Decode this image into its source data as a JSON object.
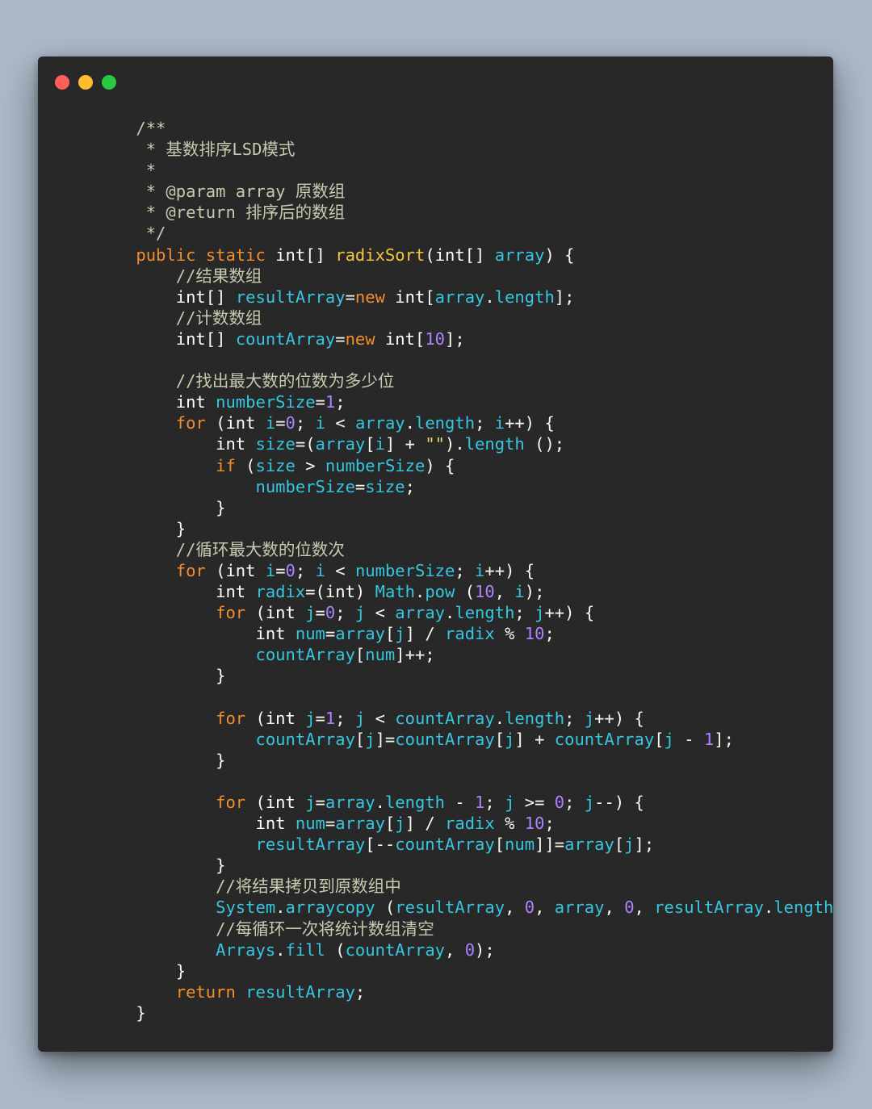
{
  "window": {
    "traffic_lights": [
      {
        "name": "close",
        "color": "#fe5f57"
      },
      {
        "name": "minimize",
        "color": "#febc2e"
      },
      {
        "name": "maximize",
        "color": "#28c840"
      }
    ]
  },
  "colors": {
    "background": "#abb9c8",
    "editor_background": "#282828",
    "comment": "#c9c9b0",
    "keyword": "#f28d2e",
    "type": "#ffffff",
    "function": "#f5c43b",
    "variable": "#36c6df",
    "number": "#ae81ff"
  },
  "code": {
    "language": "java",
    "lines": [
      [
        [
          "    /**",
          "c"
        ]
      ],
      [
        [
          "     * 基数排序LSD模式",
          "c"
        ]
      ],
      [
        [
          "     *",
          "c"
        ]
      ],
      [
        [
          "     * @param array 原数组",
          "c"
        ]
      ],
      [
        [
          "     * @return 排序后的数组",
          "c"
        ]
      ],
      [
        [
          "     */",
          "c"
        ]
      ],
      [
        [
          "    ",
          "o"
        ],
        [
          "public",
          "k"
        ],
        [
          " ",
          "o"
        ],
        [
          "static",
          "k"
        ],
        [
          " ",
          "o"
        ],
        [
          "int",
          "t"
        ],
        [
          "[] ",
          "o"
        ],
        [
          "radixSort",
          "f"
        ],
        [
          "(",
          "o"
        ],
        [
          "int",
          "t"
        ],
        [
          "[] ",
          "o"
        ],
        [
          "array",
          "v"
        ],
        [
          ") {",
          "o"
        ]
      ],
      [
        [
          "        //结果数组",
          "c"
        ]
      ],
      [
        [
          "        ",
          "o"
        ],
        [
          "int",
          "t"
        ],
        [
          "[] ",
          "o"
        ],
        [
          "resultArray",
          "v"
        ],
        [
          "=",
          "o"
        ],
        [
          "new",
          "k"
        ],
        [
          " ",
          "o"
        ],
        [
          "int",
          "t"
        ],
        [
          "[",
          "o"
        ],
        [
          "array",
          "v"
        ],
        [
          ".",
          "o"
        ],
        [
          "length",
          "v"
        ],
        [
          "];",
          "o"
        ]
      ],
      [
        [
          "        //计数数组",
          "c"
        ]
      ],
      [
        [
          "        ",
          "o"
        ],
        [
          "int",
          "t"
        ],
        [
          "[] ",
          "o"
        ],
        [
          "countArray",
          "v"
        ],
        [
          "=",
          "o"
        ],
        [
          "new",
          "k"
        ],
        [
          " ",
          "o"
        ],
        [
          "int",
          "t"
        ],
        [
          "[",
          "o"
        ],
        [
          "10",
          "n"
        ],
        [
          "];",
          "o"
        ]
      ],
      [
        [
          "",
          "o"
        ]
      ],
      [
        [
          "        //找出最大数的位数为多少位",
          "c"
        ]
      ],
      [
        [
          "        ",
          "o"
        ],
        [
          "int",
          "t"
        ],
        [
          " ",
          "o"
        ],
        [
          "numberSize",
          "v"
        ],
        [
          "=",
          "o"
        ],
        [
          "1",
          "n"
        ],
        [
          ";",
          "o"
        ]
      ],
      [
        [
          "        ",
          "o"
        ],
        [
          "for",
          "k"
        ],
        [
          " (",
          "o"
        ],
        [
          "int",
          "t"
        ],
        [
          " ",
          "o"
        ],
        [
          "i",
          "v"
        ],
        [
          "=",
          "o"
        ],
        [
          "0",
          "n"
        ],
        [
          "; ",
          "o"
        ],
        [
          "i",
          "v"
        ],
        [
          " < ",
          "o"
        ],
        [
          "array",
          "v"
        ],
        [
          ".",
          "o"
        ],
        [
          "length",
          "v"
        ],
        [
          "; ",
          "o"
        ],
        [
          "i",
          "v"
        ],
        [
          "++) {",
          "o"
        ]
      ],
      [
        [
          "            ",
          "o"
        ],
        [
          "int",
          "t"
        ],
        [
          " ",
          "o"
        ],
        [
          "size",
          "v"
        ],
        [
          "=(",
          "o"
        ],
        [
          "array",
          "v"
        ],
        [
          "[",
          "o"
        ],
        [
          "i",
          "v"
        ],
        [
          "] + ",
          "o"
        ],
        [
          "\"\"",
          "s"
        ],
        [
          ").",
          "o"
        ],
        [
          "length",
          "v"
        ],
        [
          " ();",
          "o"
        ]
      ],
      [
        [
          "            ",
          "o"
        ],
        [
          "if",
          "k"
        ],
        [
          " (",
          "o"
        ],
        [
          "size",
          "v"
        ],
        [
          " > ",
          "o"
        ],
        [
          "numberSize",
          "v"
        ],
        [
          ") {",
          "o"
        ]
      ],
      [
        [
          "                ",
          "o"
        ],
        [
          "numberSize",
          "v"
        ],
        [
          "=",
          "o"
        ],
        [
          "size",
          "v"
        ],
        [
          ";",
          "o"
        ]
      ],
      [
        [
          "            }",
          "o"
        ]
      ],
      [
        [
          "        }",
          "o"
        ]
      ],
      [
        [
          "        //循环最大数的位数次",
          "c"
        ]
      ],
      [
        [
          "        ",
          "o"
        ],
        [
          "for",
          "k"
        ],
        [
          " (",
          "o"
        ],
        [
          "int",
          "t"
        ],
        [
          " ",
          "o"
        ],
        [
          "i",
          "v"
        ],
        [
          "=",
          "o"
        ],
        [
          "0",
          "n"
        ],
        [
          "; ",
          "o"
        ],
        [
          "i",
          "v"
        ],
        [
          " < ",
          "o"
        ],
        [
          "numberSize",
          "v"
        ],
        [
          "; ",
          "o"
        ],
        [
          "i",
          "v"
        ],
        [
          "++) {",
          "o"
        ]
      ],
      [
        [
          "            ",
          "o"
        ],
        [
          "int",
          "t"
        ],
        [
          " ",
          "o"
        ],
        [
          "radix",
          "v"
        ],
        [
          "=(",
          "o"
        ],
        [
          "int",
          "t"
        ],
        [
          ") ",
          "o"
        ],
        [
          "Math",
          "v"
        ],
        [
          ".",
          "o"
        ],
        [
          "pow",
          "v"
        ],
        [
          " (",
          "o"
        ],
        [
          "10",
          "n"
        ],
        [
          ", ",
          "o"
        ],
        [
          "i",
          "v"
        ],
        [
          ");",
          "o"
        ]
      ],
      [
        [
          "            ",
          "o"
        ],
        [
          "for",
          "k"
        ],
        [
          " (",
          "o"
        ],
        [
          "int",
          "t"
        ],
        [
          " ",
          "o"
        ],
        [
          "j",
          "v"
        ],
        [
          "=",
          "o"
        ],
        [
          "0",
          "n"
        ],
        [
          "; ",
          "o"
        ],
        [
          "j",
          "v"
        ],
        [
          " < ",
          "o"
        ],
        [
          "array",
          "v"
        ],
        [
          ".",
          "o"
        ],
        [
          "length",
          "v"
        ],
        [
          "; ",
          "o"
        ],
        [
          "j",
          "v"
        ],
        [
          "++) {",
          "o"
        ]
      ],
      [
        [
          "                ",
          "o"
        ],
        [
          "int",
          "t"
        ],
        [
          " ",
          "o"
        ],
        [
          "num",
          "v"
        ],
        [
          "=",
          "o"
        ],
        [
          "array",
          "v"
        ],
        [
          "[",
          "o"
        ],
        [
          "j",
          "v"
        ],
        [
          "] / ",
          "o"
        ],
        [
          "radix",
          "v"
        ],
        [
          " % ",
          "o"
        ],
        [
          "10",
          "n"
        ],
        [
          ";",
          "o"
        ]
      ],
      [
        [
          "                ",
          "o"
        ],
        [
          "countArray",
          "v"
        ],
        [
          "[",
          "o"
        ],
        [
          "num",
          "v"
        ],
        [
          "]++;",
          "o"
        ]
      ],
      [
        [
          "            }",
          "o"
        ]
      ],
      [
        [
          "",
          "o"
        ]
      ],
      [
        [
          "            ",
          "o"
        ],
        [
          "for",
          "k"
        ],
        [
          " (",
          "o"
        ],
        [
          "int",
          "t"
        ],
        [
          " ",
          "o"
        ],
        [
          "j",
          "v"
        ],
        [
          "=",
          "o"
        ],
        [
          "1",
          "n"
        ],
        [
          "; ",
          "o"
        ],
        [
          "j",
          "v"
        ],
        [
          " < ",
          "o"
        ],
        [
          "countArray",
          "v"
        ],
        [
          ".",
          "o"
        ],
        [
          "length",
          "v"
        ],
        [
          "; ",
          "o"
        ],
        [
          "j",
          "v"
        ],
        [
          "++) {",
          "o"
        ]
      ],
      [
        [
          "                ",
          "o"
        ],
        [
          "countArray",
          "v"
        ],
        [
          "[",
          "o"
        ],
        [
          "j",
          "v"
        ],
        [
          "]=",
          "o"
        ],
        [
          "countArray",
          "v"
        ],
        [
          "[",
          "o"
        ],
        [
          "j",
          "v"
        ],
        [
          "] + ",
          "o"
        ],
        [
          "countArray",
          "v"
        ],
        [
          "[",
          "o"
        ],
        [
          "j",
          "v"
        ],
        [
          " - ",
          "o"
        ],
        [
          "1",
          "n"
        ],
        [
          "];",
          "o"
        ]
      ],
      [
        [
          "            }",
          "o"
        ]
      ],
      [
        [
          "",
          "o"
        ]
      ],
      [
        [
          "            ",
          "o"
        ],
        [
          "for",
          "k"
        ],
        [
          " (",
          "o"
        ],
        [
          "int",
          "t"
        ],
        [
          " ",
          "o"
        ],
        [
          "j",
          "v"
        ],
        [
          "=",
          "o"
        ],
        [
          "array",
          "v"
        ],
        [
          ".",
          "o"
        ],
        [
          "length",
          "v"
        ],
        [
          " - ",
          "o"
        ],
        [
          "1",
          "n"
        ],
        [
          "; ",
          "o"
        ],
        [
          "j",
          "v"
        ],
        [
          " >= ",
          "o"
        ],
        [
          "0",
          "n"
        ],
        [
          "; ",
          "o"
        ],
        [
          "j",
          "v"
        ],
        [
          "--) {",
          "o"
        ]
      ],
      [
        [
          "                ",
          "o"
        ],
        [
          "int",
          "t"
        ],
        [
          " ",
          "o"
        ],
        [
          "num",
          "v"
        ],
        [
          "=",
          "o"
        ],
        [
          "array",
          "v"
        ],
        [
          "[",
          "o"
        ],
        [
          "j",
          "v"
        ],
        [
          "] / ",
          "o"
        ],
        [
          "radix",
          "v"
        ],
        [
          " % ",
          "o"
        ],
        [
          "10",
          "n"
        ],
        [
          ";",
          "o"
        ]
      ],
      [
        [
          "                ",
          "o"
        ],
        [
          "resultArray",
          "v"
        ],
        [
          "[--",
          "o"
        ],
        [
          "countArray",
          "v"
        ],
        [
          "[",
          "o"
        ],
        [
          "num",
          "v"
        ],
        [
          "]]=",
          "o"
        ],
        [
          "array",
          "v"
        ],
        [
          "[",
          "o"
        ],
        [
          "j",
          "v"
        ],
        [
          "];",
          "o"
        ]
      ],
      [
        [
          "            }",
          "o"
        ]
      ],
      [
        [
          "            //将结果拷贝到原数组中",
          "c"
        ]
      ],
      [
        [
          "            ",
          "o"
        ],
        [
          "System",
          "v"
        ],
        [
          ".",
          "o"
        ],
        [
          "arraycopy",
          "v"
        ],
        [
          " (",
          "o"
        ],
        [
          "resultArray",
          "v"
        ],
        [
          ", ",
          "o"
        ],
        [
          "0",
          "n"
        ],
        [
          ", ",
          "o"
        ],
        [
          "array",
          "v"
        ],
        [
          ", ",
          "o"
        ],
        [
          "0",
          "n"
        ],
        [
          ", ",
          "o"
        ],
        [
          "resultArray",
          "v"
        ],
        [
          ".",
          "o"
        ],
        [
          "length",
          "v"
        ],
        [
          ");",
          "o"
        ]
      ],
      [
        [
          "            //每循环一次将统计数组清空",
          "c"
        ]
      ],
      [
        [
          "            ",
          "o"
        ],
        [
          "Arrays",
          "v"
        ],
        [
          ".",
          "o"
        ],
        [
          "fill",
          "v"
        ],
        [
          " (",
          "o"
        ],
        [
          "countArray",
          "v"
        ],
        [
          ", ",
          "o"
        ],
        [
          "0",
          "n"
        ],
        [
          ");",
          "o"
        ]
      ],
      [
        [
          "        }",
          "o"
        ]
      ],
      [
        [
          "        ",
          "o"
        ],
        [
          "return",
          "k"
        ],
        [
          " ",
          "o"
        ],
        [
          "resultArray",
          "v"
        ],
        [
          ";",
          "o"
        ]
      ],
      [
        [
          "    }",
          "o"
        ]
      ]
    ]
  }
}
